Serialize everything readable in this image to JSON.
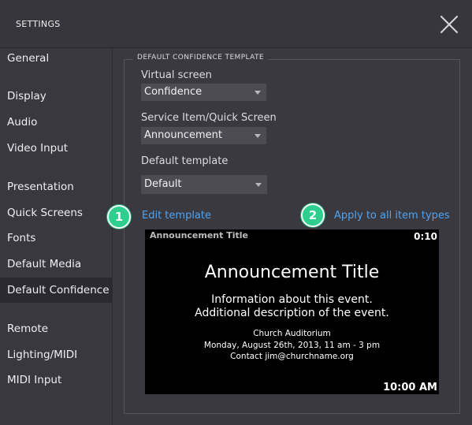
{
  "window": {
    "title": "SETTINGS",
    "close_icon": "close-icon"
  },
  "sidebar": {
    "items": [
      {
        "label": "General"
      },
      {
        "label": "Display"
      },
      {
        "label": "Audio"
      },
      {
        "label": "Video Input"
      },
      {
        "label": "Presentation"
      },
      {
        "label": "Quick Screens"
      },
      {
        "label": "Fonts"
      },
      {
        "label": "Default Media"
      },
      {
        "label": "Default Confidence",
        "active": true
      },
      {
        "label": "Remote"
      },
      {
        "label": "Lighting/MIDI"
      },
      {
        "label": "MIDI Input"
      }
    ]
  },
  "panel": {
    "group_title": "DEFAULT CONFIDENCE TEMPLATE",
    "virtual_screen": {
      "label": "Virtual screen",
      "value": "Confidence"
    },
    "service_item": {
      "label": "Service Item/Quick Screen",
      "value": "Announcement"
    },
    "default_template": {
      "label": "Default template",
      "value": "Default"
    },
    "edit_link": "Edit template",
    "apply_link": "Apply to all item types",
    "badges": [
      "1",
      "2"
    ],
    "badge_color": "#2ecf8e",
    "link_color": "#4fa3f0"
  },
  "preview": {
    "small_title": "Announcement Title",
    "timer": "0:10",
    "heading": "Announcement Title",
    "body_line1": "Information about this event.",
    "body_line2": "Additional description of the event.",
    "detail_line1": "Church Auditorium",
    "detail_line2": "Monday, August 26th, 2013, 11 am - 3 pm",
    "detail_line3": "Contact jim@churchname.org",
    "clock": "10:00 AM"
  }
}
